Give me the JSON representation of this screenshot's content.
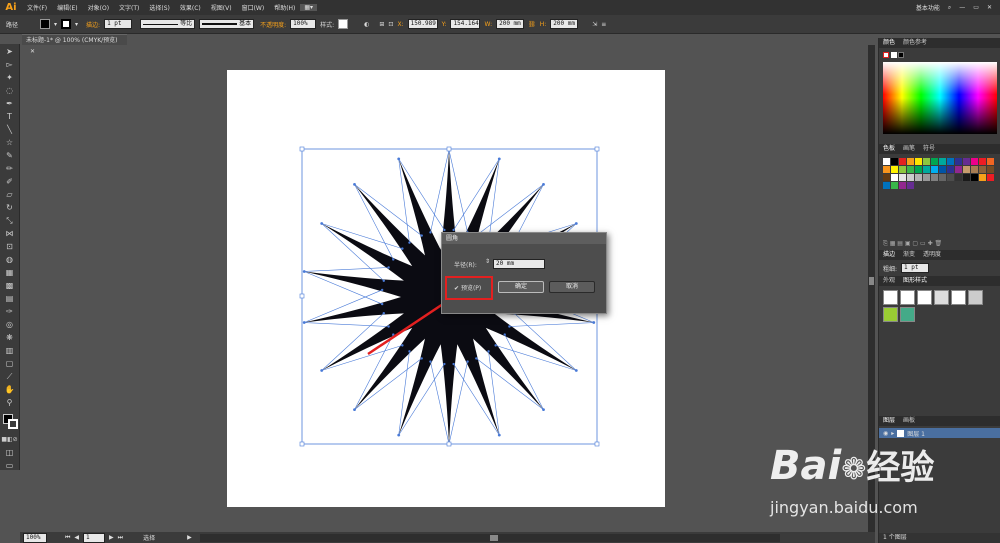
{
  "app": {
    "logo": "Ai"
  },
  "menu": [
    "文件(F)",
    "编辑(E)",
    "对象(O)",
    "文字(T)",
    "选择(S)",
    "效果(C)",
    "视图(V)",
    "窗口(W)",
    "帮助(H)"
  ],
  "menu_right": {
    "workspace": "基本功能"
  },
  "control": {
    "path_label": "路径",
    "stroke_label": "描边:",
    "stroke_value": "1 pt",
    "uniform_label": "等比",
    "basic_label": "基本",
    "opacity_label": "不透明度:",
    "opacity_value": "100%",
    "style_label": "样式:",
    "x_value": "150.989",
    "y_value": "154.164",
    "w_value": "200 mm",
    "h_value": "200 mm"
  },
  "document": {
    "tab_title": "未标题-1* @ 100% (CMYK/预览)"
  },
  "dialog": {
    "title": "圆角",
    "radius_label": "半径(R):",
    "radius_value": "20 mm",
    "preview_label": "预览(P)",
    "ok_label": "确定",
    "cancel_label": "取消"
  },
  "status": {
    "zoom": "100%",
    "page": "1",
    "tool": "选择"
  },
  "panels": {
    "color_tabs": [
      "颜色",
      "颜色参考"
    ],
    "swatch_tabs": [
      "色板",
      "画笔",
      "符号"
    ],
    "stroke_tabs": [
      "描边",
      "渐变",
      "透明度"
    ],
    "stroke_weight_label": "粗细:",
    "stroke_weight_value": "1 pt",
    "appearance_tabs": [
      "外观",
      "图形样式"
    ],
    "layer_tabs": [
      "图层",
      "画板"
    ],
    "layer_name": "图层 1",
    "layer_count": "1 个图层"
  },
  "watermark": {
    "brand": "Bai",
    "brand2": "经验",
    "url": "jingyan.baidu.com"
  },
  "colors": {
    "accent_orange": "#f7a11a",
    "annotation_red": "#e32020",
    "selection_blue": "#4a7bd8"
  }
}
